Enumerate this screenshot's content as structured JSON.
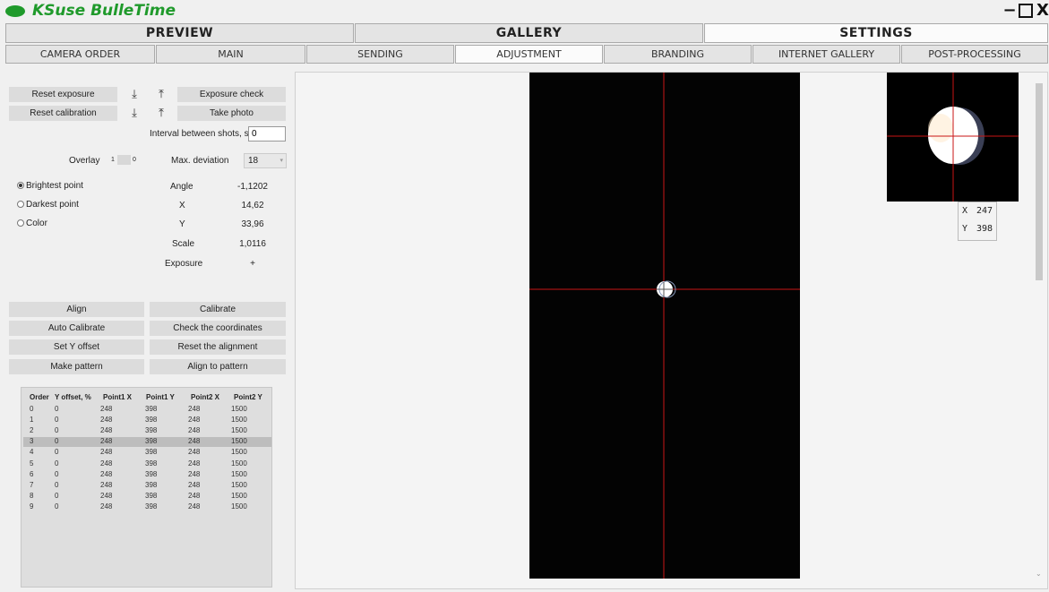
{
  "app": {
    "title": "KSuse BulleTime",
    "minimize": "−",
    "close": "X"
  },
  "main_tabs": [
    {
      "label": "PREVIEW",
      "active": false
    },
    {
      "label": "GALLERY",
      "active": false
    },
    {
      "label": "SETTINGS",
      "active": true
    }
  ],
  "sub_tabs": [
    {
      "label": "CAMERA ORDER",
      "active": false
    },
    {
      "label": "MAIN",
      "active": false
    },
    {
      "label": "SENDING",
      "active": false
    },
    {
      "label": "ADJUSTMENT",
      "active": true
    },
    {
      "label": "BRANDING",
      "active": false
    },
    {
      "label": "INTERNET GALLERY",
      "active": false
    },
    {
      "label": "POST-PROCESSING",
      "active": false
    }
  ],
  "controls": {
    "reset_exposure": "Reset exposure",
    "reset_calibration": "Reset calibration",
    "exposure_check": "Exposure check",
    "take_photo": "Take photo",
    "interval_label": "Interval between shots, s",
    "interval_value": "0",
    "overlay_label": "Overlay",
    "overlay_left": "1",
    "overlay_right": "0",
    "max_deviation_label": "Max. deviation",
    "max_deviation_value": "18",
    "download_icon": "⤓",
    "upload_icon": "⤒"
  },
  "mode": {
    "brightest": "Brightest point",
    "darkest": "Darkest point",
    "color": "Color",
    "selected": "brightest"
  },
  "readouts": {
    "angle_label": "Angle",
    "angle_value": "-1,1202",
    "x_label": "X",
    "x_value": "14,62",
    "y_label": "Y",
    "y_value": "33,96",
    "scale_label": "Scale",
    "scale_value": "1,0116",
    "exposure_label": "Exposure",
    "exposure_value": "+"
  },
  "actions": {
    "align": "Align",
    "calibrate": "Calibrate",
    "auto_calibrate": "Auto Calibrate",
    "check_coordinates": "Check the coordinates",
    "set_y_offset": "Set Y offset",
    "reset_alignment": "Reset the alignment",
    "make_pattern": "Make pattern",
    "align_to_pattern": "Align to pattern"
  },
  "table": {
    "headers": [
      "Order",
      "Y offset, %",
      "Point1 X",
      "Point1 Y",
      "Point2 X",
      "Point2 Y"
    ],
    "selected_row": 3,
    "rows": [
      [
        "0",
        "0",
        "248",
        "398",
        "248",
        "1500"
      ],
      [
        "1",
        "0",
        "248",
        "398",
        "248",
        "1500"
      ],
      [
        "2",
        "0",
        "248",
        "398",
        "248",
        "1500"
      ],
      [
        "3",
        "0",
        "248",
        "398",
        "248",
        "1500"
      ],
      [
        "4",
        "0",
        "248",
        "398",
        "248",
        "1500"
      ],
      [
        "5",
        "0",
        "248",
        "398",
        "248",
        "1500"
      ],
      [
        "6",
        "0",
        "248",
        "398",
        "248",
        "1500"
      ],
      [
        "7",
        "0",
        "248",
        "398",
        "248",
        "1500"
      ],
      [
        "8",
        "0",
        "248",
        "398",
        "248",
        "1500"
      ],
      [
        "9",
        "0",
        "248",
        "398",
        "248",
        "1500"
      ]
    ]
  },
  "zoom_coords": {
    "x_label": "X",
    "x_value": "247",
    "y_label": "Y",
    "y_value": "398"
  },
  "colors": {
    "brand": "#1f9a2b",
    "crosshair": "#c81414"
  }
}
